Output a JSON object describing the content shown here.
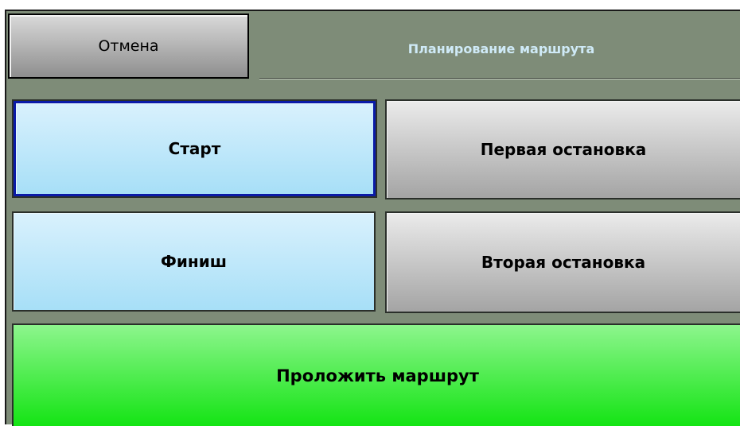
{
  "header": {
    "cancel_label": "Отмена",
    "title": "Планирование маршрута"
  },
  "route_points": {
    "start_label": "Старт",
    "first_stop_label": "Первая остановка",
    "finish_label": "Финиш",
    "second_stop_label": "Вторая остановка"
  },
  "action": {
    "build_route_label": "Проложить маршрут"
  },
  "colors": {
    "background": "#7e8c78",
    "title_text": "#cfeaf7",
    "endpoint_button": "#bfe8fa",
    "stop_button": "#c8c8c8",
    "build_button": "#3cea3c",
    "selected_border": "#0a1aa8"
  }
}
